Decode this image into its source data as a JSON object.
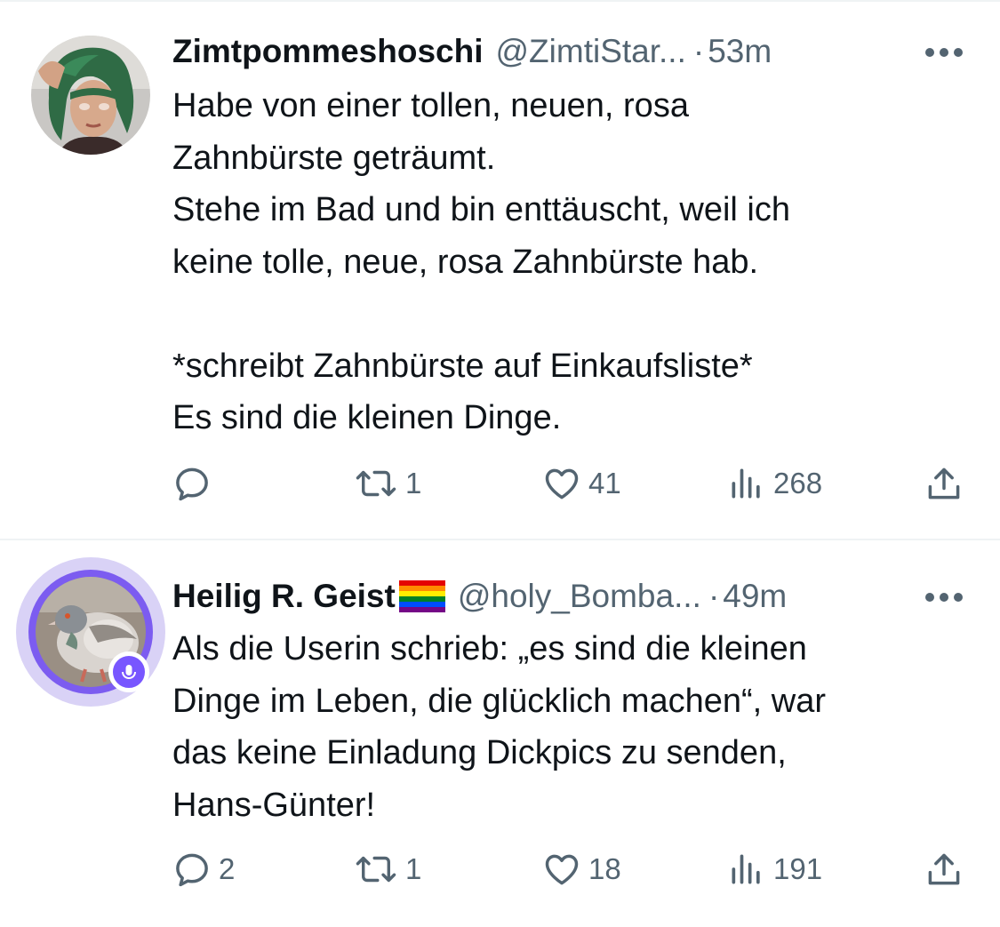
{
  "tweets": [
    {
      "display_name": "Zimtpommeshoschi",
      "handle": "@ZimtiStar...",
      "separator": "·",
      "time": "53m",
      "avatar": "user-photo-green-hair",
      "lines": [
        "Habe von einer tollen, neuen, rosa",
        "Zahnbürste geträumt.",
        "Stehe im Bad und bin enttäuscht, weil ich",
        "keine tolle, neue, rosa Zahnbürste hab.",
        "",
        "*schreibt Zahnbürste auf Einkaufsliste*",
        "Es sind die kleinen Dinge."
      ],
      "actions": {
        "reply": "",
        "retweet": "1",
        "like": "41",
        "views": "268"
      }
    },
    {
      "display_name": "Heilig R. Geist",
      "display_name_emoji": "rainbow-flag-icon",
      "handle": "@holy_Bomba...",
      "separator": "·",
      "time": "49m",
      "avatar": "pigeon-photo",
      "avatar_ring": "spaces-live-ring",
      "lines": [
        "Als die Userin schrieb: „es sind die kleinen",
        "Dinge im Leben, die glücklich machen“, war",
        "das keine Einladung Dickpics zu senden,",
        "Hans-Günter!"
      ],
      "actions": {
        "reply": "2",
        "retweet": "1",
        "like": "18",
        "views": "191"
      }
    }
  ],
  "icons": {
    "reply": "reply-icon",
    "retweet": "retweet-icon",
    "like": "heart-icon",
    "views": "views-icon",
    "share": "share-icon",
    "more": "more-icon"
  },
  "colors": {
    "text_primary": "#0f1419",
    "text_secondary": "#536471",
    "divider": "#eff3f4",
    "spaces_ring": "#7856ff"
  }
}
